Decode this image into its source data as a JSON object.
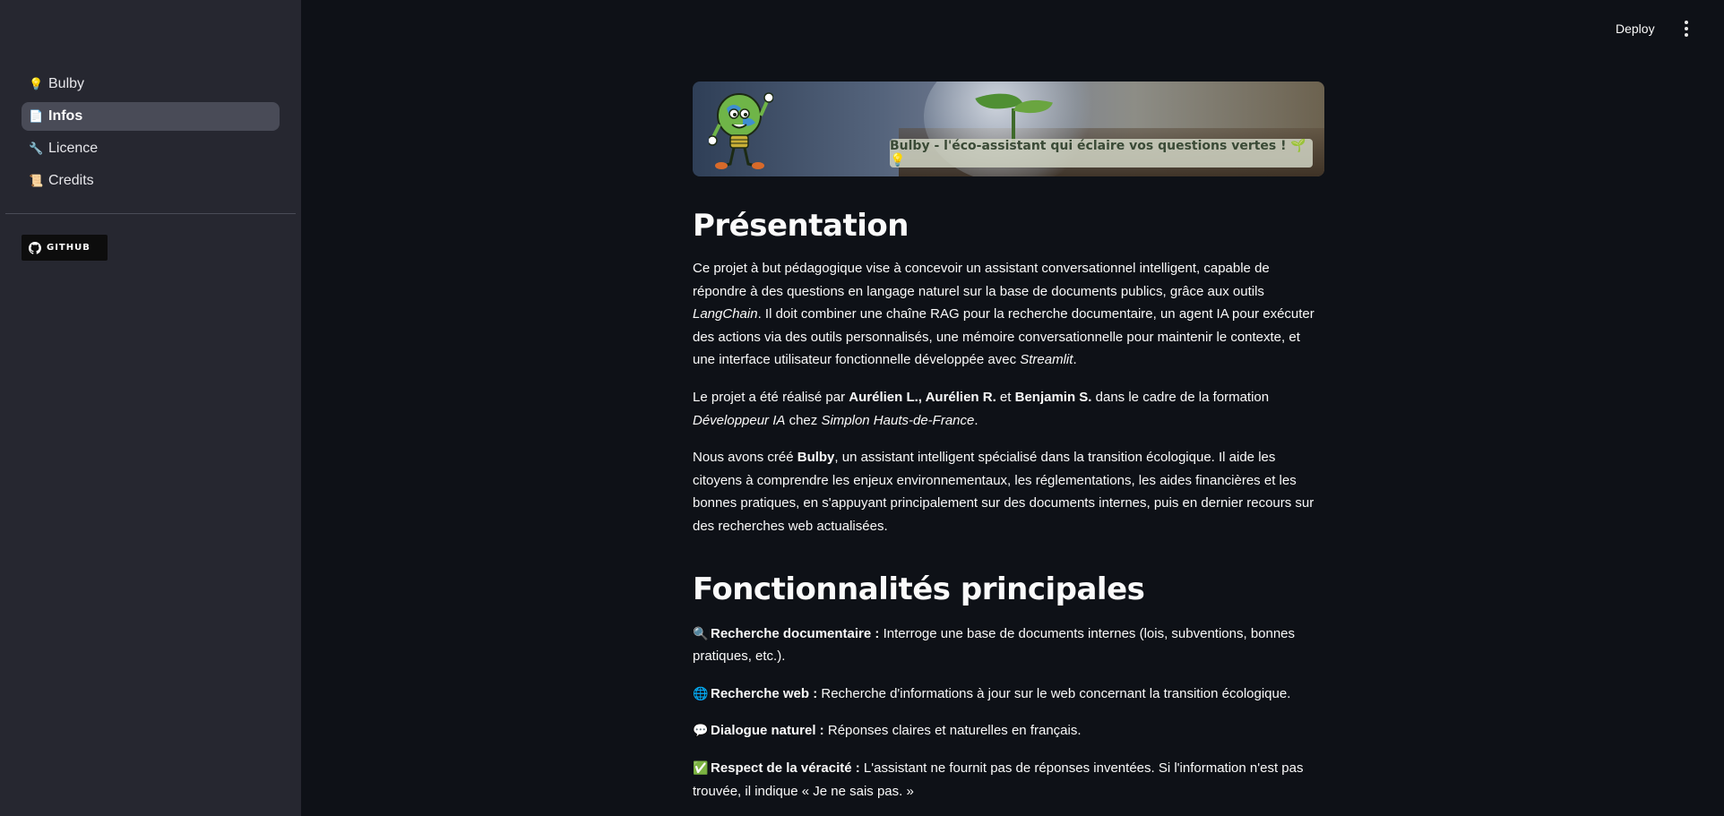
{
  "sidebar": {
    "items": [
      {
        "label": "Bulby",
        "icon": "lightbulb-icon",
        "glyph": "💡",
        "active": false
      },
      {
        "label": "Infos",
        "icon": "page-icon",
        "glyph": "📄",
        "active": true
      },
      {
        "label": "Licence",
        "icon": "wrench-icon",
        "glyph": "🔧",
        "active": false
      },
      {
        "label": "Credits",
        "icon": "scroll-icon",
        "glyph": "📜",
        "active": false
      }
    ],
    "github_badge": "GITHUB"
  },
  "header": {
    "deploy_label": "Deploy",
    "menu_icon": "kebab-menu-icon"
  },
  "banner": {
    "caption": "Bulby - l'éco-assistant qui éclaire vos questions vertes ! 🌱💡"
  },
  "main": {
    "presentation": {
      "heading": "Présentation",
      "p1_a": "Ce projet à but pédagogique vise à concevoir un assistant conversationnel intelligent, capable de répondre à des questions en langage naturel sur la base de documents publics, grâce aux outils ",
      "p1_langchain": "LangChain",
      "p1_b": ". Il doit combiner une chaîne RAG pour la recherche documentaire, un agent IA pour exécuter des actions via des outils personnalisés, une mémoire conversationnelle pour maintenir le contexte, et une interface utilisateur fonctionnelle développée avec ",
      "p1_streamlit": "Streamlit",
      "p1_c": ".",
      "p2_a": "Le projet a été réalisé par ",
      "p2_author1": "Aurélien L.",
      "p2_sep1": ", ",
      "p2_author2": "Aurélien R.",
      "p2_sep2": " et ",
      "p2_author3": "Benjamin S.",
      "p2_b": " dans le cadre de la formation ",
      "p2_formation": "Développeur IA",
      "p2_c": " chez ",
      "p2_school": "Simplon Hauts-de-France",
      "p2_d": ".",
      "p3_a": "Nous avons créé ",
      "p3_bulby": "Bulby",
      "p3_b": ", un assistant intelligent spécialisé dans la transition écologique. Il aide les citoyens à comprendre les enjeux environnementaux, les réglementations, les aides financières et les bonnes pratiques, en s'appuyant principalement sur des documents internes, puis en dernier recours sur des recherches web actualisées."
    },
    "features": {
      "heading": "Fonctionnalités principales",
      "items": [
        {
          "glyph": "🔍",
          "icon": "magnifier-icon",
          "title": "Recherche documentaire :",
          "text": " Interroge une base de documents internes (lois, subventions, bonnes pratiques, etc.)."
        },
        {
          "glyph": "🌐",
          "icon": "globe-icon",
          "title": "Recherche web :",
          "text": " Recherche d'informations à jour sur le web concernant la transition écologique."
        },
        {
          "glyph": "💬",
          "icon": "speech-bubble-icon",
          "title": "Dialogue naturel :",
          "text": " Réponses claires et naturelles en français."
        },
        {
          "glyph": "✅",
          "icon": "check-mark-icon",
          "title": "Respect de la véracité :",
          "text": " L'assistant ne fournit pas de réponses inventées. Si l'information n'est pas trouvée, il indique « Je ne sais pas. »"
        }
      ]
    }
  }
}
